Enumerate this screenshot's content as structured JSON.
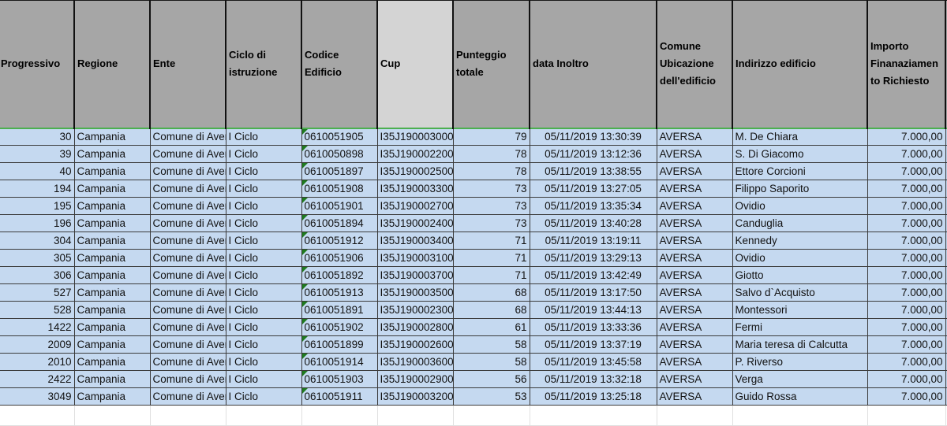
{
  "headers": {
    "progressivo": "Progressivo",
    "regione": "Regione",
    "ente": "Ente",
    "ciclo": "Ciclo di istruzione",
    "codice": "Codice Edificio",
    "cup": "Cup",
    "punteggio": "Punteggio totale",
    "data": "data Inoltro",
    "comune": "Comune Ubicazione dell'edificio",
    "indirizzo": "Indirizzo edificio",
    "importo": "Importo Finanaziamen to Richiesto"
  },
  "rows": [
    {
      "progressivo": "30",
      "regione": "Campania",
      "ente": "Comune di Aversa",
      "ciclo": "I Ciclo",
      "codice": "0610051905",
      "cup": "I35J190003000",
      "punteggio": "79",
      "data": "05/11/2019 13:30:39",
      "comune": "AVERSA",
      "indirizzo": "M. De Chiara",
      "importo": "7.000,00"
    },
    {
      "progressivo": "39",
      "regione": "Campania",
      "ente": "Comune di Aversa",
      "ciclo": "I Ciclo",
      "codice": "0610050898",
      "cup": "I35J190002200",
      "punteggio": "78",
      "data": "05/11/2019 13:12:36",
      "comune": "AVERSA",
      "indirizzo": "S. Di Giacomo",
      "importo": "7.000,00"
    },
    {
      "progressivo": "40",
      "regione": "Campania",
      "ente": "Comune di Aversa",
      "ciclo": "I Ciclo",
      "codice": "0610051897",
      "cup": "I35J190002500",
      "punteggio": "78",
      "data": "05/11/2019 13:38:55",
      "comune": "AVERSA",
      "indirizzo": "Ettore Corcioni",
      "importo": "7.000,00"
    },
    {
      "progressivo": "194",
      "regione": "Campania",
      "ente": "Comune di Aversa",
      "ciclo": "I Ciclo",
      "codice": "0610051908",
      "cup": "I35J190003300",
      "punteggio": "73",
      "data": "05/11/2019 13:27:05",
      "comune": "AVERSA",
      "indirizzo": "Filippo Saporito",
      "importo": "7.000,00"
    },
    {
      "progressivo": "195",
      "regione": "Campania",
      "ente": "Comune di Aversa",
      "ciclo": "I Ciclo",
      "codice": "0610051901",
      "cup": "I35J190002700",
      "punteggio": "73",
      "data": "05/11/2019 13:35:34",
      "comune": "AVERSA",
      "indirizzo": "Ovidio",
      "importo": "7.000,00"
    },
    {
      "progressivo": "196",
      "regione": "Campania",
      "ente": "Comune di Aversa",
      "ciclo": "I Ciclo",
      "codice": "0610051894",
      "cup": "I35J190002400",
      "punteggio": "73",
      "data": "05/11/2019 13:40:28",
      "comune": "AVERSA",
      "indirizzo": "Canduglia",
      "importo": "7.000,00"
    },
    {
      "progressivo": "304",
      "regione": "Campania",
      "ente": "Comune di Aversa",
      "ciclo": "I Ciclo",
      "codice": "0610051912",
      "cup": "I35J190003400",
      "punteggio": "71",
      "data": "05/11/2019 13:19:11",
      "comune": "AVERSA",
      "indirizzo": "Kennedy",
      "importo": "7.000,00"
    },
    {
      "progressivo": "305",
      "regione": "Campania",
      "ente": "Comune di Aversa",
      "ciclo": "I Ciclo",
      "codice": "0610051906",
      "cup": "I35J190003100",
      "punteggio": "71",
      "data": "05/11/2019 13:29:13",
      "comune": "AVERSA",
      "indirizzo": "Ovidio",
      "importo": "7.000,00"
    },
    {
      "progressivo": "306",
      "regione": "Campania",
      "ente": "Comune di Aversa",
      "ciclo": "I Ciclo",
      "codice": "0610051892",
      "cup": "I35J190003700",
      "punteggio": "71",
      "data": "05/11/2019 13:42:49",
      "comune": "AVERSA",
      "indirizzo": "Giotto",
      "importo": "7.000,00"
    },
    {
      "progressivo": "527",
      "regione": "Campania",
      "ente": "Comune di Aversa",
      "ciclo": "I Ciclo",
      "codice": "0610051913",
      "cup": "I35J190003500",
      "punteggio": "68",
      "data": "05/11/2019 13:17:50",
      "comune": "AVERSA",
      "indirizzo": "Salvo d`Acquisto",
      "importo": "7.000,00"
    },
    {
      "progressivo": "528",
      "regione": "Campania",
      "ente": "Comune di Aversa",
      "ciclo": "I Ciclo",
      "codice": "0610051891",
      "cup": "I35J190002300",
      "punteggio": "68",
      "data": "05/11/2019 13:44:13",
      "comune": "AVERSA",
      "indirizzo": "Montessori",
      "importo": "7.000,00"
    },
    {
      "progressivo": "1422",
      "regione": "Campania",
      "ente": "Comune di Aversa",
      "ciclo": "I Ciclo",
      "codice": "0610051902",
      "cup": "I35J190002800",
      "punteggio": "61",
      "data": "05/11/2019 13:33:36",
      "comune": "AVERSA",
      "indirizzo": "Fermi",
      "importo": "7.000,00"
    },
    {
      "progressivo": "2009",
      "regione": "Campania",
      "ente": "Comune di Aversa",
      "ciclo": "I Ciclo",
      "codice": "0610051899",
      "cup": "I35J190002600",
      "punteggio": "58",
      "data": "05/11/2019 13:37:19",
      "comune": "AVERSA",
      "indirizzo": "Maria teresa di Calcutta",
      "importo": "7.000,00"
    },
    {
      "progressivo": "2010",
      "regione": "Campania",
      "ente": "Comune di Aversa",
      "ciclo": "I Ciclo",
      "codice": "0610051914",
      "cup": "I35J190003600",
      "punteggio": "58",
      "data": "05/11/2019 13:45:58",
      "comune": "AVERSA",
      "indirizzo": "P. Riverso",
      "importo": "7.000,00"
    },
    {
      "progressivo": "2422",
      "regione": "Campania",
      "ente": "Comune di Aversa",
      "ciclo": "I Ciclo",
      "codice": "0610051903",
      "cup": "I35J190002900",
      "punteggio": "56",
      "data": "05/11/2019 13:32:18",
      "comune": "AVERSA",
      "indirizzo": "Verga",
      "importo": "7.000,00"
    },
    {
      "progressivo": "3049",
      "regione": "Campania",
      "ente": "Comune di Aversa",
      "ciclo": "I Ciclo",
      "codice": "0610051911",
      "cup": "I35J190003200",
      "punteggio": "53",
      "data": "05/11/2019 13:25:18",
      "comune": "AVERSA",
      "indirizzo": "Guido Rossa",
      "importo": "7.000,00"
    }
  ],
  "colors": {
    "header_bg": "#a6a6a6",
    "cup_header_bg": "#d4d4d4",
    "row_bg": "#c5d9f0",
    "flag_green": "#1f7a1f"
  }
}
